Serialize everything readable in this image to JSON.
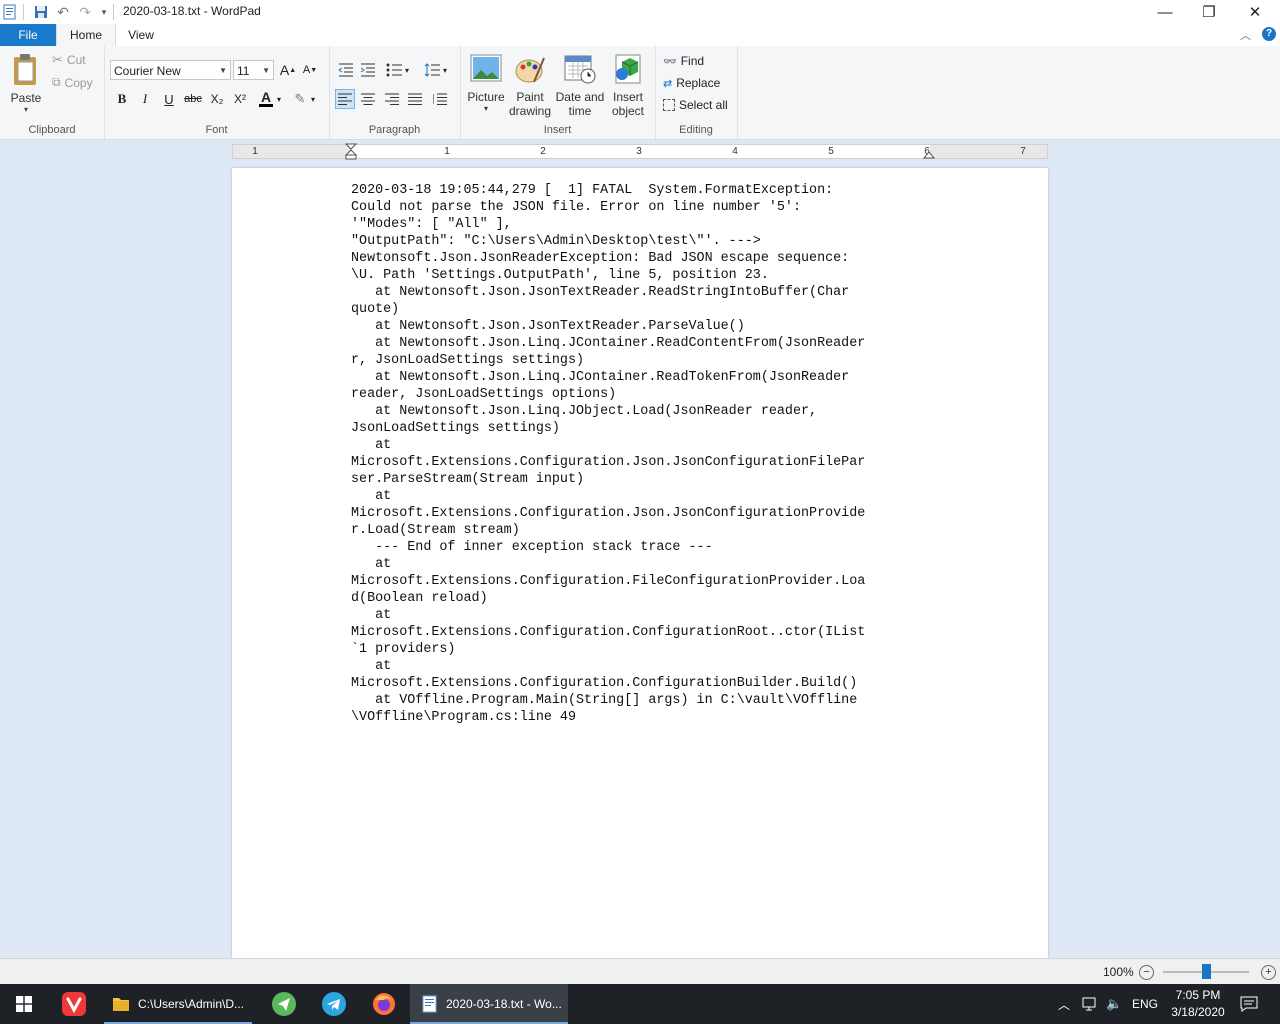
{
  "window": {
    "title": "2020-03-18.txt - WordPad",
    "minimize_glyph": "—",
    "maximize_glyph": "❐",
    "close_glyph": "✕"
  },
  "tabs": [
    {
      "label": "File"
    },
    {
      "label": "Home"
    },
    {
      "label": "View"
    }
  ],
  "ribbon": {
    "clipboard": {
      "label": "Clipboard",
      "paste": "Paste",
      "cut": "Cut",
      "copy": "Copy"
    },
    "font": {
      "label": "Font",
      "family": "Courier New",
      "size": "11",
      "bold": "B",
      "italic": "I",
      "underline": "U",
      "strikethrough": "abc",
      "subscript": "X₂",
      "superscript": "X²",
      "grow": "A",
      "shrink": "A",
      "text_color_glyph": "A"
    },
    "paragraph": {
      "label": "Paragraph"
    },
    "insert": {
      "label": "Insert",
      "picture": "Picture",
      "paint_line1": "Paint",
      "paint_line2": "drawing",
      "datetime_line1": "Date and",
      "datetime_line2": "time",
      "object_line1": "Insert",
      "object_line2": "object"
    },
    "editing": {
      "label": "Editing",
      "find": "Find",
      "replace": "Replace",
      "select_all": "Select all"
    }
  },
  "ruler": {
    "numbers": [
      "1",
      "1",
      "2",
      "3",
      "4",
      "5",
      "6",
      "7"
    ]
  },
  "document": {
    "text": "2020-03-18 19:05:44,279 [  1] FATAL  System.FormatException:\nCould not parse the JSON file. Error on line number '5':\n'\"Modes\": [ \"All\" ],\n\"OutputPath\": \"C:\\Users\\Admin\\Desktop\\test\\\"'. --->\nNewtonsoft.Json.JsonReaderException: Bad JSON escape sequence:\n\\U. Path 'Settings.OutputPath', line 5, position 23.\n   at Newtonsoft.Json.JsonTextReader.ReadStringIntoBuffer(Char\nquote)\n   at Newtonsoft.Json.JsonTextReader.ParseValue()\n   at Newtonsoft.Json.Linq.JContainer.ReadContentFrom(JsonReader\nr, JsonLoadSettings settings)\n   at Newtonsoft.Json.Linq.JContainer.ReadTokenFrom(JsonReader\nreader, JsonLoadSettings options)\n   at Newtonsoft.Json.Linq.JObject.Load(JsonReader reader,\nJsonLoadSettings settings)\n   at\nMicrosoft.Extensions.Configuration.Json.JsonConfigurationFilePar\nser.ParseStream(Stream input)\n   at\nMicrosoft.Extensions.Configuration.Json.JsonConfigurationProvide\nr.Load(Stream stream)\n   --- End of inner exception stack trace ---\n   at\nMicrosoft.Extensions.Configuration.FileConfigurationProvider.Loa\nd(Boolean reload)\n   at\nMicrosoft.Extensions.Configuration.ConfigurationRoot..ctor(IList\n`1 providers)\n   at\nMicrosoft.Extensions.Configuration.ConfigurationBuilder.Build()\n   at VOffline.Program.Main(String[] args) in C:\\vault\\VOffline\n\\VOffline\\Program.cs:line 49"
  },
  "statusbar": {
    "zoom": "100%",
    "zoom_level": 1.0
  },
  "taskbar": {
    "explorer_label": "C:\\Users\\Admin\\D...",
    "wordpad_label": "2020-03-18.txt - Wo...",
    "language": "ENG",
    "time": "7:05 PM",
    "date": "3/18/2020"
  },
  "icons": {
    "app": "wordpad-icon",
    "start": "windows-start-icon",
    "vivaldi": "vivaldi-icon",
    "folder": "folder-icon",
    "telegram": "telegram-icon",
    "firefox": "firefox-icon"
  },
  "colors": {
    "accent": "#1979ca",
    "taskbar": "#1e2126",
    "doc_background": "#dfe9f5"
  }
}
